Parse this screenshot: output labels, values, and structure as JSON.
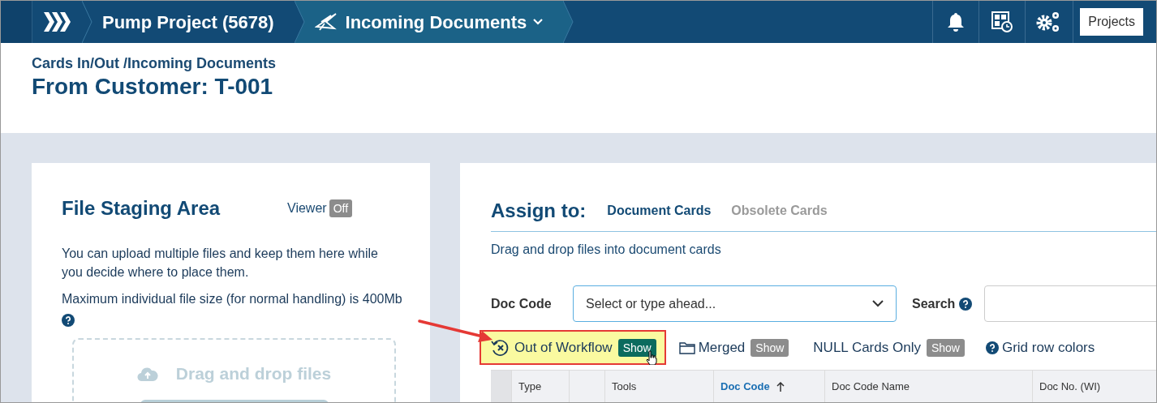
{
  "header": {
    "crumbs": [
      {
        "kind": "logo"
      },
      {
        "kind": "text",
        "label": "Pump Project (5678)"
      },
      {
        "kind": "menu",
        "label": "Incoming Documents"
      }
    ],
    "projects_button": "Projects"
  },
  "page": {
    "path": "Cards In/Out /Incoming Documents",
    "title": "From Customer: T-001"
  },
  "staging": {
    "title": "File Staging Area",
    "viewer_label": "Viewer",
    "viewer_toggle": {
      "label": "Off",
      "on": false
    },
    "text_1": "You can upload multiple files and keep them here while you decide where to place them.",
    "text_2": "Maximum individual file size (for normal handling) is 400Mb",
    "dropzone": "Drag and drop files"
  },
  "assign": {
    "title": "Assign to:",
    "tabs": [
      {
        "label": "Document Cards",
        "selected": true
      },
      {
        "label": "Obsolete Cards",
        "selected": false
      }
    ],
    "hint": "Drag and drop files into document cards",
    "doc_code": {
      "label": "Doc Code",
      "placeholder": "Select or type ahead..."
    },
    "search": {
      "label": "Search"
    },
    "filters": [
      {
        "kind": "workflow",
        "label": "Out of Workflow",
        "toggle": "Show",
        "on": true,
        "highlighted": true
      },
      {
        "kind": "folder",
        "label": "Merged",
        "toggle": "Show",
        "on": false,
        "highlighted": false
      },
      {
        "kind": "plain",
        "label": "NULL Cards Only",
        "toggle": "Show",
        "on": false,
        "highlighted": false
      },
      {
        "kind": "help",
        "label": "Grid row colors"
      }
    ],
    "columns": [
      {
        "kind": "select"
      },
      {
        "kind": "text",
        "label": "Type"
      },
      {
        "kind": "blank"
      },
      {
        "kind": "text",
        "label": "Tools"
      },
      {
        "kind": "text",
        "label": "Doc Code",
        "sorted": true,
        "ascending": true
      },
      {
        "kind": "text",
        "label": "Doc Code Name"
      },
      {
        "kind": "text",
        "label": "Doc No. (WI)"
      }
    ]
  }
}
